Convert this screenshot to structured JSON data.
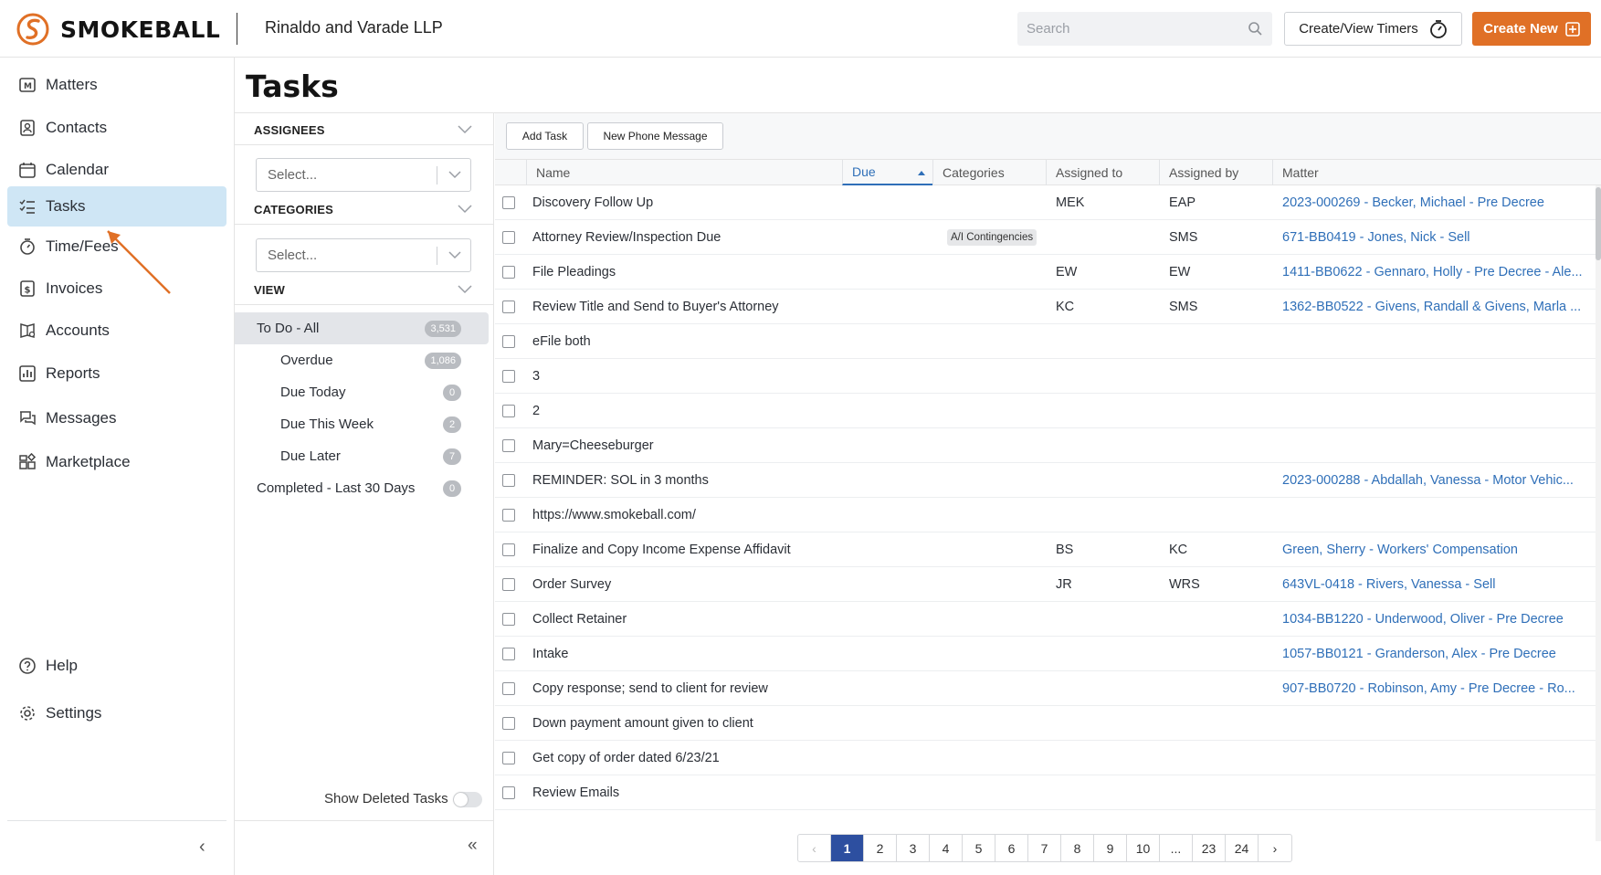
{
  "brand": {
    "name": "SMOKEBALL",
    "accent": "#e07026"
  },
  "header": {
    "firm_name": "Rinaldo and Varade LLP",
    "search_placeholder": "Search",
    "timers_label": "Create/View Timers",
    "create_label": "Create New"
  },
  "sidebar": {
    "items": [
      {
        "label": "Matters",
        "icon": "matters-icon"
      },
      {
        "label": "Contacts",
        "icon": "contacts-icon"
      },
      {
        "label": "Calendar",
        "icon": "calendar-icon"
      },
      {
        "label": "Tasks",
        "icon": "tasks-icon",
        "active": true
      },
      {
        "label": "Time/Fees",
        "icon": "stopwatch-icon"
      },
      {
        "label": "Invoices",
        "icon": "invoice-icon"
      },
      {
        "label": "Accounts",
        "icon": "accounts-icon"
      },
      {
        "label": "Reports",
        "icon": "reports-icon"
      },
      {
        "label": "Messages",
        "icon": "messages-icon"
      },
      {
        "label": "Marketplace",
        "icon": "marketplace-icon"
      }
    ],
    "bottom": [
      {
        "label": "Help",
        "icon": "help-icon"
      },
      {
        "label": "Settings",
        "icon": "gear-icon"
      }
    ]
  },
  "page": {
    "title": "Tasks"
  },
  "filters": {
    "assignees": {
      "heading": "ASSIGNEES",
      "placeholder": "Select..."
    },
    "categories": {
      "heading": "CATEGORIES",
      "placeholder": "Select..."
    },
    "view": {
      "heading": "VIEW",
      "items": [
        {
          "label": "To Do - All",
          "count": "3,531",
          "active": true
        },
        {
          "label": "Overdue",
          "count": "1,086"
        },
        {
          "label": "Due Today",
          "count": "0"
        },
        {
          "label": "Due This Week",
          "count": "2"
        },
        {
          "label": "Due Later",
          "count": "7"
        },
        {
          "label": "Completed - Last 30 Days",
          "count": "0"
        }
      ]
    },
    "show_deleted_label": "Show Deleted Tasks"
  },
  "toolbar": {
    "add_task": "Add Task",
    "new_phone_message": "New Phone Message"
  },
  "table": {
    "columns": [
      "Name",
      "Due",
      "Categories",
      "Assigned to",
      "Assigned by",
      "Matter"
    ],
    "rows": [
      {
        "name": "Discovery Follow Up",
        "due": "",
        "category": "",
        "assigned_to": "MEK",
        "assigned_by": "EAP",
        "matter": "2023-000269 - Becker, Michael - Pre Decree"
      },
      {
        "name": "Attorney Review/Inspection Due",
        "due": "",
        "category": "A/I Contingencies",
        "assigned_to": "",
        "assigned_by": "SMS",
        "matter": "671-BB0419 - Jones, Nick - Sell"
      },
      {
        "name": "File Pleadings",
        "due": "",
        "category": "",
        "assigned_to": "EW",
        "assigned_by": "EW",
        "matter": "1411-BB0622 - Gennaro, Holly - Pre Decree - Ale..."
      },
      {
        "name": "Review Title and Send to Buyer's Attorney",
        "due": "",
        "category": "",
        "assigned_to": "KC",
        "assigned_by": "SMS",
        "matter": "1362-BB0522 - Givens, Randall & Givens, Marla ..."
      },
      {
        "name": "eFile both",
        "due": "",
        "category": "",
        "assigned_to": "",
        "assigned_by": "",
        "matter": ""
      },
      {
        "name": "3",
        "due": "",
        "category": "",
        "assigned_to": "",
        "assigned_by": "",
        "matter": ""
      },
      {
        "name": "2",
        "due": "",
        "category": "",
        "assigned_to": "",
        "assigned_by": "",
        "matter": ""
      },
      {
        "name": "Mary=Cheeseburger",
        "due": "",
        "category": "",
        "assigned_to": "",
        "assigned_by": "",
        "matter": ""
      },
      {
        "name": "REMINDER: SOL in 3 months",
        "due": "",
        "category": "",
        "assigned_to": "",
        "assigned_by": "",
        "matter": "2023-000288 - Abdallah, Vanessa - Motor Vehic..."
      },
      {
        "name": "https://www.smokeball.com/",
        "due": "",
        "category": "",
        "assigned_to": "",
        "assigned_by": "",
        "matter": ""
      },
      {
        "name": "Finalize and Copy Income Expense Affidavit",
        "due": "",
        "category": "",
        "assigned_to": "BS",
        "assigned_by": "KC",
        "matter": "Green, Sherry - Workers' Compensation"
      },
      {
        "name": "Order Survey",
        "due": "",
        "category": "",
        "assigned_to": "JR",
        "assigned_by": "WRS",
        "matter": "643VL-0418 - Rivers, Vanessa - Sell"
      },
      {
        "name": "Collect Retainer",
        "due": "",
        "category": "",
        "assigned_to": "",
        "assigned_by": "",
        "matter": "1034-BB1220 - Underwood, Oliver - Pre Decree"
      },
      {
        "name": "Intake",
        "due": "",
        "category": "",
        "assigned_to": "",
        "assigned_by": "",
        "matter": "1057-BB0121 - Granderson, Alex - Pre Decree"
      },
      {
        "name": "Copy response; send to client for review",
        "due": "",
        "category": "",
        "assigned_to": "",
        "assigned_by": "",
        "matter": "907-BB0720 - Robinson, Amy - Pre Decree - Ro..."
      },
      {
        "name": "Down payment amount given to client",
        "due": "",
        "category": "",
        "assigned_to": "",
        "assigned_by": "",
        "matter": ""
      },
      {
        "name": "Get copy of order dated 6/23/21",
        "due": "",
        "category": "",
        "assigned_to": "",
        "assigned_by": "",
        "matter": ""
      },
      {
        "name": "Review Emails",
        "due": "",
        "category": "",
        "assigned_to": "",
        "assigned_by": "",
        "matter": ""
      }
    ]
  },
  "pagination": {
    "prev": "‹",
    "next": "›",
    "pages": [
      "1",
      "2",
      "3",
      "4",
      "5",
      "6",
      "7",
      "8",
      "9",
      "10",
      "...",
      "23",
      "24"
    ],
    "current": "1"
  }
}
